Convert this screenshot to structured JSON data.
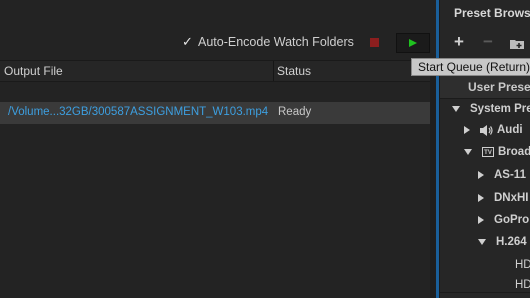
{
  "queue": {
    "auto_encode_checkbox_mark": "✓",
    "auto_encode_label": "Auto-Encode Watch Folders",
    "auto_encode_checked": true
  },
  "table": {
    "columns": [
      "Output File",
      "Status"
    ],
    "rows": [
      {
        "output_file": "/Volume...32GB/300587ASSIGNMENT_W103.mp4",
        "status": "Ready"
      }
    ]
  },
  "tooltip": {
    "text": "Start Queue (Return)"
  },
  "preset_browser": {
    "title": "Preset Browser",
    "header": "User Preset",
    "tree": [
      {
        "label": "System Pre",
        "level": 0,
        "state": "expanded"
      },
      {
        "label": "Audi",
        "level": 1,
        "state": "collapsed",
        "icon": "speaker-icon"
      },
      {
        "label": "Broad",
        "level": 1,
        "state": "expanded",
        "icon": "tv-icon"
      },
      {
        "label": "AS-11",
        "level": 2,
        "state": "collapsed"
      },
      {
        "label": "DNxHI",
        "level": 2,
        "state": "collapsed"
      },
      {
        "label": "GoPro",
        "level": 2,
        "state": "collapsed"
      },
      {
        "label": "H.264",
        "level": 2,
        "state": "expanded"
      },
      {
        "label": "HD",
        "level": 3,
        "state": "leaf"
      },
      {
        "label": "HD",
        "level": 3,
        "state": "leaf"
      }
    ]
  },
  "colors": {
    "accent_blue": "#1a5f9a",
    "file_link": "#3d9fe0",
    "start_green": "#1fc21f",
    "stop_red": "#8b1e1e"
  }
}
